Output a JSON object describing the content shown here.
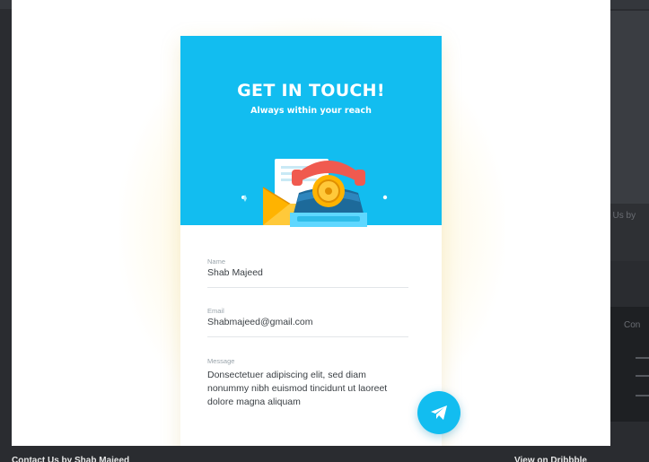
{
  "lightbox": {
    "hero_title": "GET IN TOUCH!",
    "hero_subtitle": "Always within your reach",
    "fields": [
      {
        "label": "Name",
        "value": "Shab Majeed"
      },
      {
        "label": "Email",
        "value": "Shabmajeed@gmail.com"
      },
      {
        "label": "Message",
        "value": "Donsectetuer adipiscing elit, sed diam\nnonummy nibh euismod tincidunt ut laoreet\ndolore magna aliquam"
      }
    ],
    "send_icon": "paper-plane-icon",
    "illustration_icon": "telephone-envelope-illustration"
  },
  "caption": {
    "shot_link": "Contact Us by Shab Majeed",
    "view_link": "View on Dribbble"
  },
  "background": {
    "right_text_1": "ct Us by",
    "right_text_2": "Con"
  },
  "colors": {
    "accent": "#12bdf0",
    "page_bg": "#2a2c30",
    "glow": "#ffe178",
    "phone_red": "#f05a4f",
    "envelope_yellow": "#ffb300"
  }
}
